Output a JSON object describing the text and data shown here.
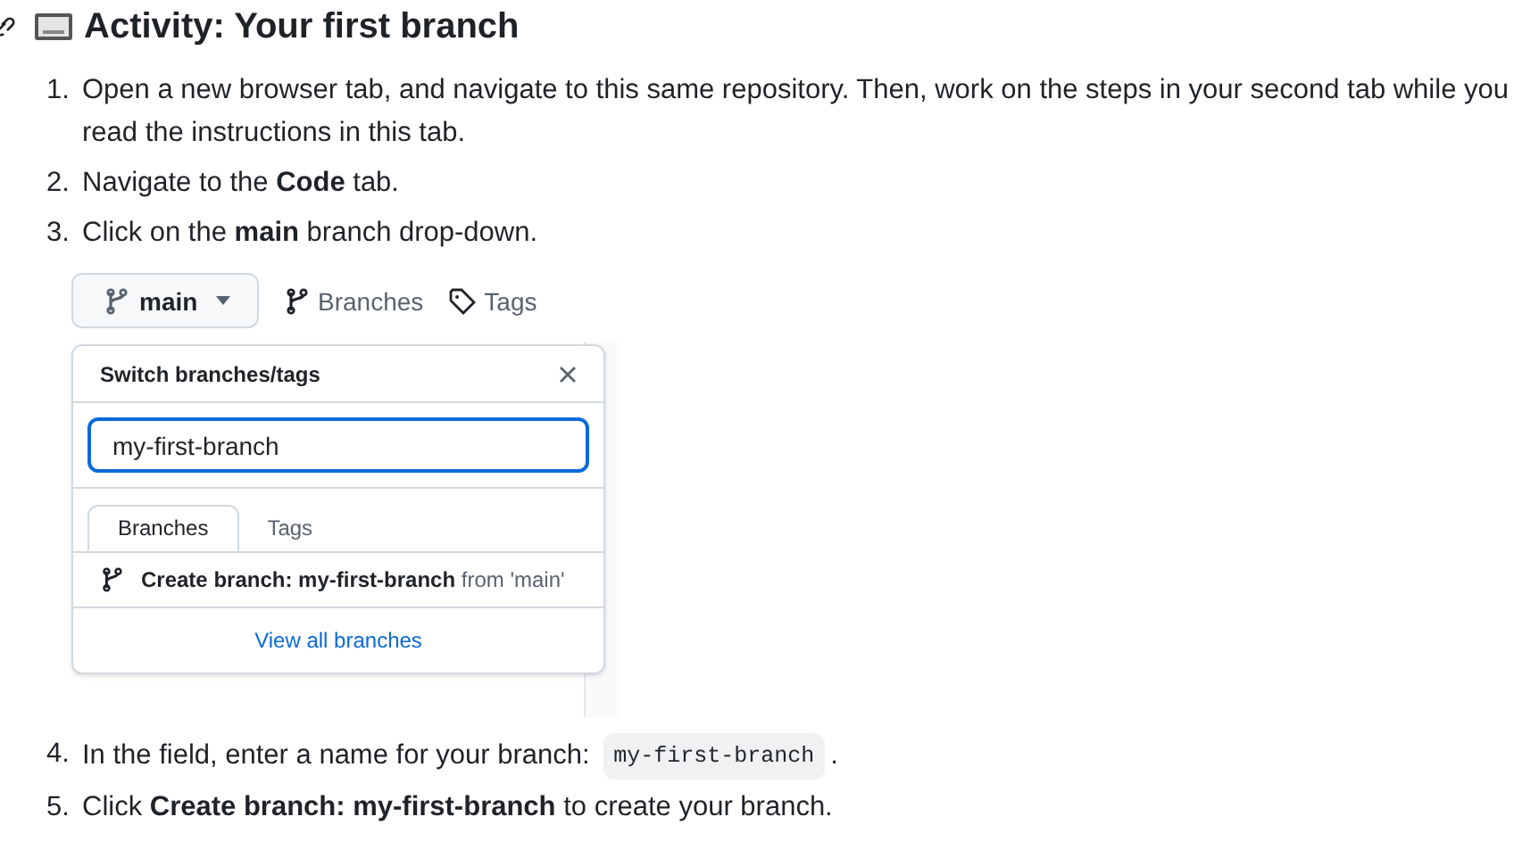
{
  "heading": {
    "title": "Activity: Your first branch"
  },
  "steps": [
    {
      "number": "1.",
      "text": "Open a new browser tab, and navigate to this same repository. Then, work on the steps in your second tab while you read the instructions in this tab."
    },
    {
      "number": "2.",
      "text": "Navigate to the **Code** tab."
    },
    {
      "number": "3.",
      "text": "Click on the **main** branch drop-down."
    },
    {
      "number": "4.",
      "text": "In the field, enter a name for your branch: ",
      "code": "my-first-branch",
      "suffix": "."
    },
    {
      "number": "5.",
      "text": "Click **Create branch: my-first-branch** to create your branch."
    }
  ],
  "screenshot": {
    "branch_button": "main",
    "branches_link": "Branches",
    "tags_link": "Tags",
    "popup": {
      "title": "Switch branches/tags",
      "search_value": "my-first-branch",
      "tabs": [
        {
          "label": "Branches",
          "selected": true
        },
        {
          "label": "Tags",
          "selected": false
        }
      ],
      "create_text": "**Create branch: my-first-branch** from 'main'",
      "footer_link": "View all branches"
    }
  }
}
